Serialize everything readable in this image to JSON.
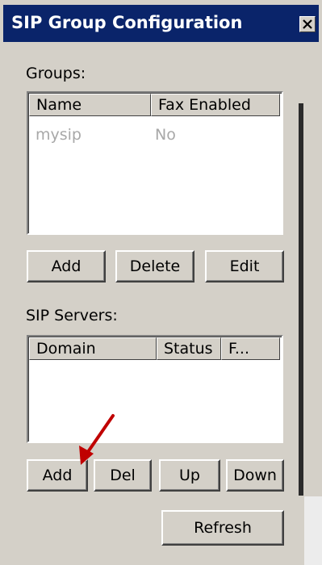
{
  "window": {
    "title": "SIP Group Configuration"
  },
  "groups": {
    "label": "Groups:",
    "columns": [
      "Name",
      "Fax Enabled"
    ],
    "rows": [
      {
        "name": "mysip",
        "fax_enabled": "No"
      }
    ],
    "buttons": {
      "add": "Add",
      "delete": "Delete",
      "edit": "Edit"
    }
  },
  "sip_servers": {
    "label": "SIP Servers:",
    "columns": [
      "Domain",
      "Status",
      "F..."
    ],
    "rows": [],
    "buttons": {
      "add": "Add",
      "del": "Del",
      "up": "Up",
      "down": "Down",
      "refresh": "Refresh"
    }
  },
  "annotation": {
    "arrow_color": "#c00000"
  }
}
